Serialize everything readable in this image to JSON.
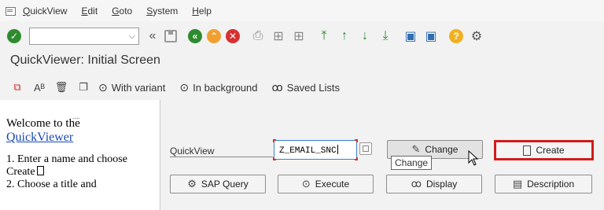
{
  "menubar": {
    "items": [
      {
        "u": "Q",
        "rest": "uickView"
      },
      {
        "u": "E",
        "rest": "dit"
      },
      {
        "u": "G",
        "rest": "oto"
      },
      {
        "u": "S",
        "rest": "ystem"
      },
      {
        "u": "H",
        "rest": "elp"
      }
    ]
  },
  "toolbar": {
    "command_field_value": "",
    "icons": [
      "enter-icon",
      "back-icon",
      "save-icon",
      "back-green-icon",
      "exit-icon",
      "cancel-icon",
      "print-icon",
      "find-icon",
      "find-next-icon",
      "first-page-icon",
      "previous-page-icon",
      "next-page-icon",
      "last-page-icon",
      "create-session-icon",
      "shortcut-icon",
      "help-icon",
      "customize-layout-icon"
    ]
  },
  "title": "QuickViewer: Initial Screen",
  "app_toolbar": {
    "with_variant": "With variant",
    "in_background": "In background",
    "saved_lists": "Saved Lists"
  },
  "left_pane": {
    "dots": ".....",
    "welcome_line1": "Welcome to the",
    "welcome_link": "QuickViewer",
    "step1": "1. Enter a name and choose",
    "step1_create": "Create",
    "step2": "2. Choose a title and"
  },
  "right_pane": {
    "quickview_label": "QuickView",
    "quickview_value": "Z_EMAIL_SNC",
    "buttons": {
      "change": "Change",
      "create": "Create",
      "sap_query": "SAP Query",
      "execute": "Execute",
      "display": "Display",
      "description": "Description"
    },
    "tooltip": "Change"
  },
  "colors": {
    "highlight_border": "#d11c1c",
    "link": "#1a4ab0",
    "confirm_green": "#2e8b2e"
  }
}
